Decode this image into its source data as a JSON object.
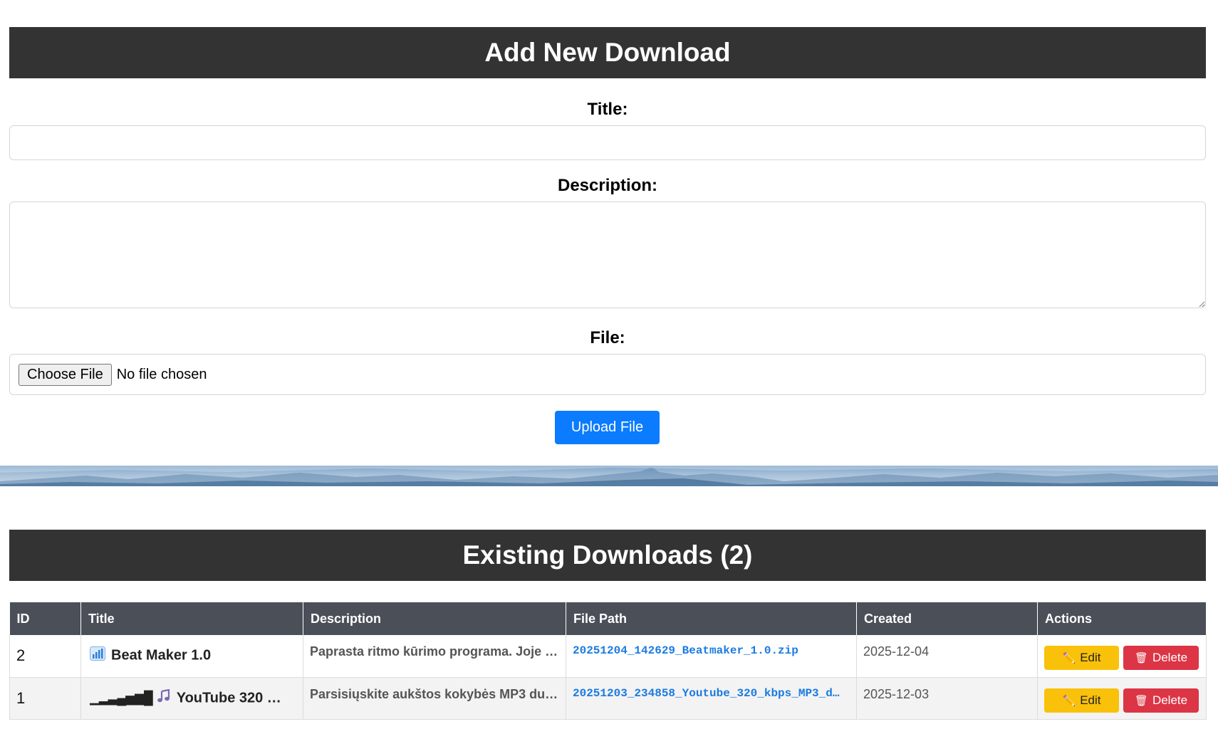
{
  "add_form": {
    "heading": "Add New Download",
    "title_label": "Title:",
    "title_value": "",
    "description_label": "Description:",
    "description_value": "",
    "file_label": "File:",
    "choose_file_label": "Choose File",
    "file_status": "No file chosen",
    "upload_label": "Upload File"
  },
  "list": {
    "heading": "Existing Downloads (2)",
    "columns": [
      "ID",
      "Title",
      "Description",
      "File Path",
      "Created",
      "Actions"
    ],
    "rows": [
      {
        "id": "2",
        "icon": "bar-chart-icon",
        "prefix": "",
        "title": "Beat Maker 1.0",
        "description": "Paprasta ritmo kūrimo programa. Joje …",
        "file_path": "20251204_142629_Beatmaker_1.0.zip",
        "created": "2025-12-04"
      },
      {
        "id": "1",
        "icon": "music-note-icon",
        "prefix": "▁▂▃▄▅▆█",
        "title": "YouTube 320 …",
        "description": "Parsisiųskite aukštos kokybės MP3 du…",
        "file_path": "20251203_234858_Youtube_320_kbps_MP3_d…",
        "created": "2025-12-03"
      }
    ],
    "edit_label": "Edit",
    "delete_label": "Delete",
    "edit_glyph": "✏️",
    "delete_glyph": "🗑"
  },
  "colors": {
    "header_bg": "#333333",
    "table_header_bg": "#4a4f58",
    "primary": "#0b7bff",
    "edit": "#f9c10a",
    "delete": "#dc3545",
    "link": "#1a7be0"
  }
}
